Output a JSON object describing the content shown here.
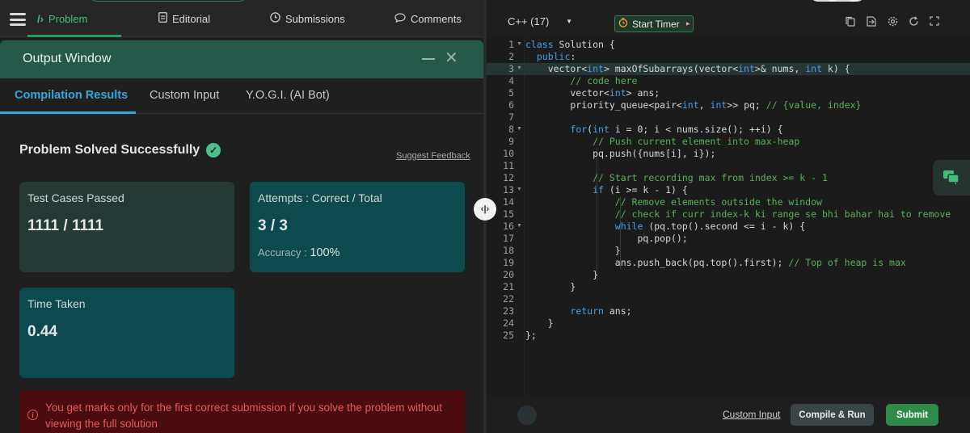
{
  "nav": {
    "tabs": [
      {
        "label": "Problem",
        "icon": "code-slash-icon"
      },
      {
        "label": "Editorial",
        "icon": "document-icon"
      },
      {
        "label": "Submissions",
        "icon": "clock-icon"
      },
      {
        "label": "Comments",
        "icon": "speech-bubble-icon"
      }
    ],
    "active_tab": "Problem"
  },
  "output_window": {
    "title": "Output Window",
    "tabs": [
      "Compilation Results",
      "Custom Input",
      "Y.O.G.I. (AI Bot)"
    ],
    "active_tab": "Compilation Results"
  },
  "result": {
    "status": "Problem Solved Successfully",
    "suggest_feedback": "Suggest Feedback",
    "test_cases_label": "Test Cases Passed",
    "test_cases_value": "1111 / 1111",
    "attempts_label": "Attempts : Correct / Total",
    "attempts_value": "3 / 3",
    "accuracy_label": "Accuracy :",
    "accuracy_value": "100%",
    "time_label": "Time Taken",
    "time_value": "0.44",
    "warning": "You get marks only for the first correct submission if you solve the problem without viewing the full solution"
  },
  "editor": {
    "language": "C++ (17)",
    "timer_label": "Start Timer",
    "toolbar_icons": [
      "copy-icon",
      "import-icon",
      "settings-icon",
      "reset-icon",
      "fullscreen-icon"
    ],
    "lines": [
      "1",
      "2",
      "3",
      "4",
      "5",
      "6",
      "7",
      "8",
      "9",
      "10",
      "11",
      "12",
      "13",
      "14",
      "15",
      "16",
      "17",
      "18",
      "19",
      "20",
      "21",
      "22",
      "23",
      "24",
      "25"
    ]
  },
  "footer": {
    "custom_input": "Custom Input",
    "compile_run": "Compile & Run",
    "submit": "Submit"
  },
  "colors": {
    "accent_green": "#2f9a5f",
    "accent_blue": "#3ba4d8",
    "card_teal": "#0c4a4f",
    "warning_red": "#e55d5d"
  }
}
